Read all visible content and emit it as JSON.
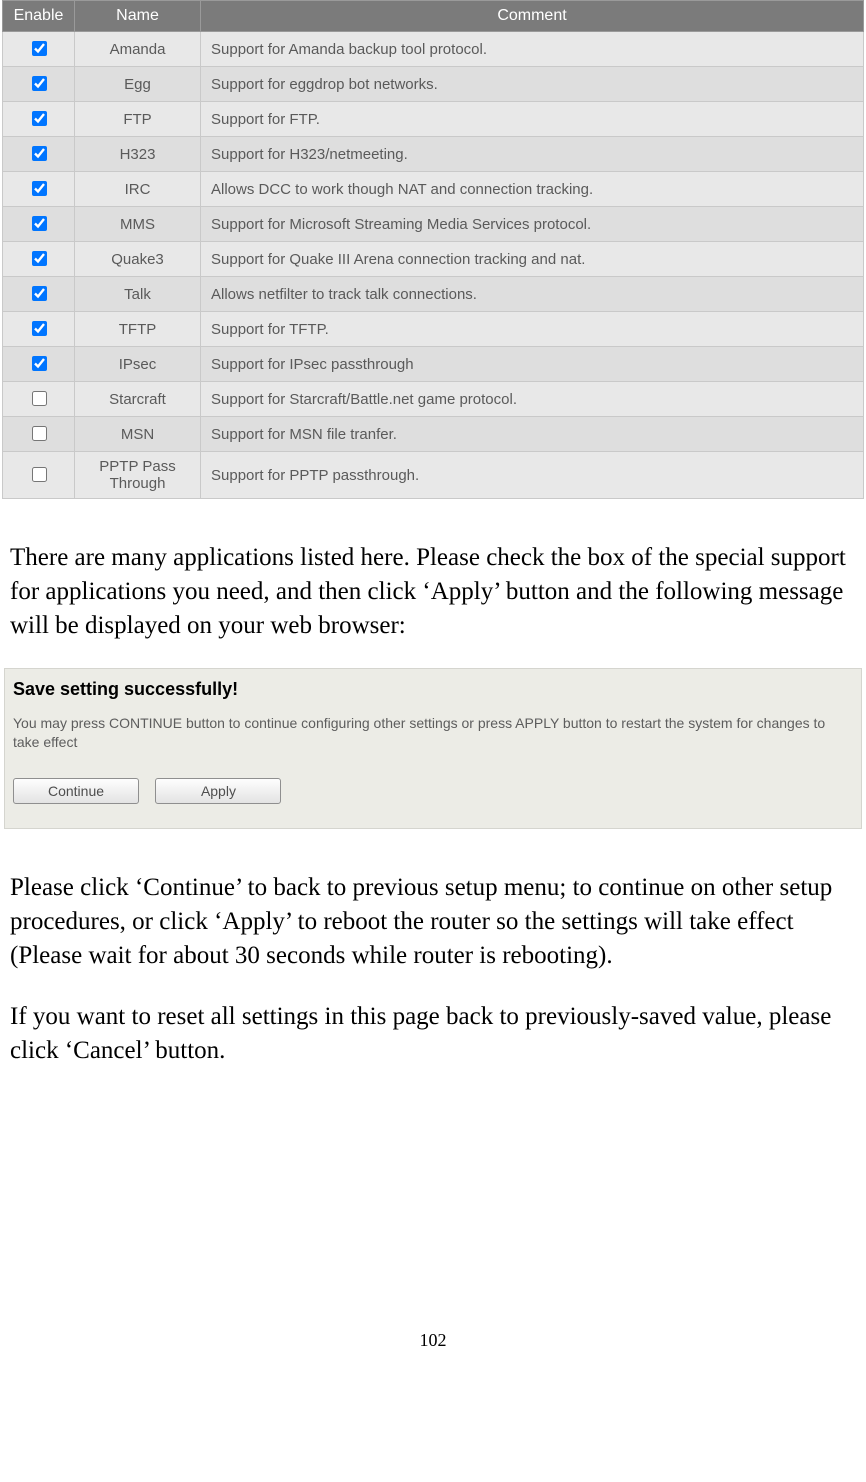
{
  "table": {
    "headers": {
      "enable": "Enable",
      "name": "Name",
      "comment": "Comment"
    },
    "rows": [
      {
        "checked": true,
        "name": "Amanda",
        "comment": "Support for Amanda backup tool protocol."
      },
      {
        "checked": true,
        "name": "Egg",
        "comment": "Support for eggdrop bot networks."
      },
      {
        "checked": true,
        "name": "FTP",
        "comment": "Support for FTP."
      },
      {
        "checked": true,
        "name": "H323",
        "comment": "Support for H323/netmeeting."
      },
      {
        "checked": true,
        "name": "IRC",
        "comment": "Allows DCC to work though NAT and connection tracking."
      },
      {
        "checked": true,
        "name": "MMS",
        "comment": "Support for Microsoft Streaming Media Services protocol."
      },
      {
        "checked": true,
        "name": "Quake3",
        "comment": "Support for Quake III Arena connection tracking and nat."
      },
      {
        "checked": true,
        "name": "Talk",
        "comment": "Allows netfilter to track talk connections."
      },
      {
        "checked": true,
        "name": "TFTP",
        "comment": "Support for TFTP."
      },
      {
        "checked": true,
        "name": "IPsec",
        "comment": "Support for IPsec passthrough"
      },
      {
        "checked": false,
        "name": "Starcraft",
        "comment": "Support for Starcraft/Battle.net game protocol."
      },
      {
        "checked": false,
        "name": "MSN",
        "comment": "Support for MSN file tranfer."
      },
      {
        "checked": false,
        "name": "PPTP Pass Through",
        "comment": "Support for PPTP passthrough."
      }
    ]
  },
  "para1": "There are many applications listed here. Please check the box of the special support for applications you need, and then click ‘Apply’ button and the following message will be displayed on your web browser:",
  "dialog": {
    "title": "Save setting successfully!",
    "message": "You may press CONTINUE button to continue configuring other settings or press APPLY button to restart the system for changes to take effect",
    "continue_label": "Continue",
    "apply_label": "Apply"
  },
  "para2": "Please click ‘Continue’ to back to previous setup menu; to continue on other setup procedures, or click ‘Apply’ to reboot the router so the settings will take effect (Please wait for about 30 seconds while router is rebooting).",
  "para3": "If you want to reset all settings in this page back to previously-saved value, please click ‘Cancel’ button.",
  "page_number": "102"
}
